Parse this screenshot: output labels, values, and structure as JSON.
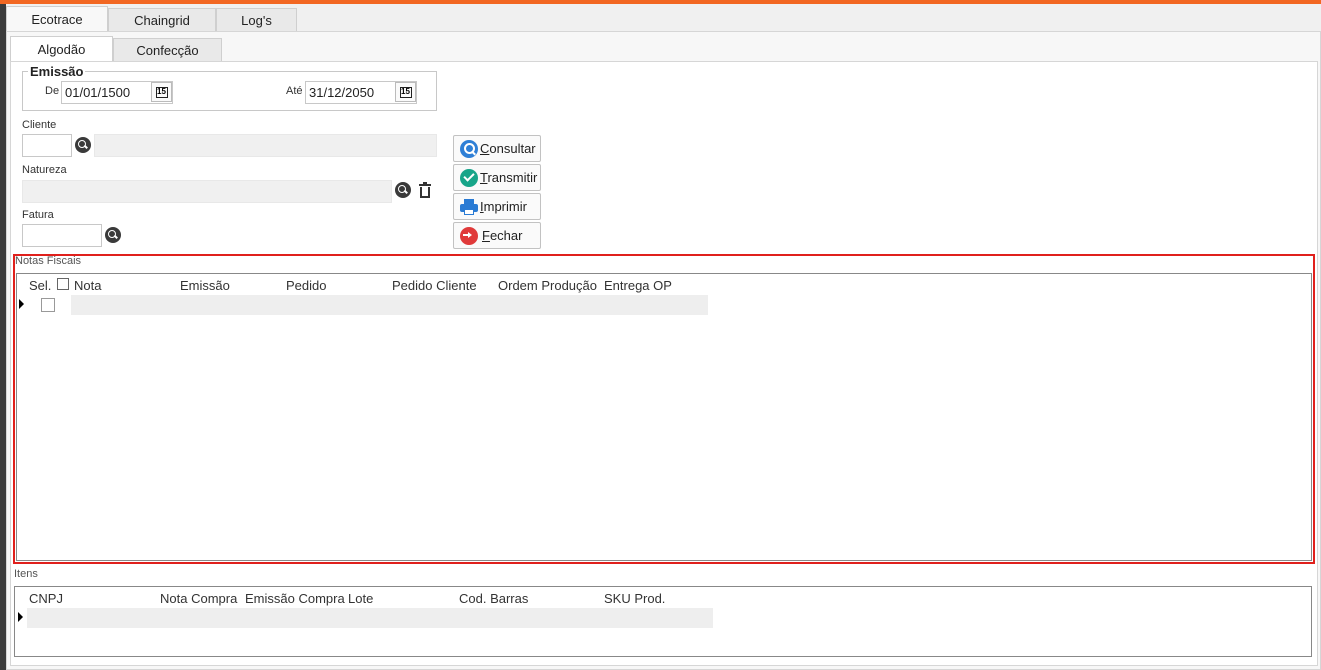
{
  "tabs_main": [
    {
      "label": "Ecotrace",
      "active": true
    },
    {
      "label": "Chaingrid",
      "active": false
    },
    {
      "label": "Log's",
      "active": false
    }
  ],
  "tabs_sub": [
    {
      "label": "Algodão",
      "active": true
    },
    {
      "label": "Confecção",
      "active": false
    }
  ],
  "emissao": {
    "legend": "Emissão",
    "from_label": "De",
    "from_value": "01/01/1500",
    "to_label": "Até",
    "to_value": "31/12/2050",
    "cal_glyph": "15"
  },
  "filters": {
    "cliente_label": "Cliente",
    "cliente_code": "",
    "cliente_name": "",
    "natureza_label": "Natureza",
    "natureza_value": "",
    "fatura_label": "Fatura",
    "fatura_value": ""
  },
  "buttons": {
    "consultar": {
      "accel": "C",
      "rest": "onsultar"
    },
    "transmitir": {
      "accel": "T",
      "rest": "ransmitir"
    },
    "imprimir": {
      "accel": "I",
      "rest": "mprimir"
    },
    "fechar": {
      "accel": "F",
      "rest": "echar"
    }
  },
  "notas": {
    "title": "Notas Fiscais",
    "columns": [
      "Sel.",
      "Nota",
      "Emissão",
      "Pedido",
      "Pedido Cliente",
      "Ordem Produção",
      "Entrega OP"
    ]
  },
  "itens": {
    "title": "Itens",
    "columns": [
      "CNPJ",
      "Nota Compra",
      "Emissão Compra",
      "Lote",
      "Cod. Barras",
      "SKU Prod."
    ]
  },
  "colors": {
    "accent": "#f26722",
    "highlight": "#e0201c"
  }
}
